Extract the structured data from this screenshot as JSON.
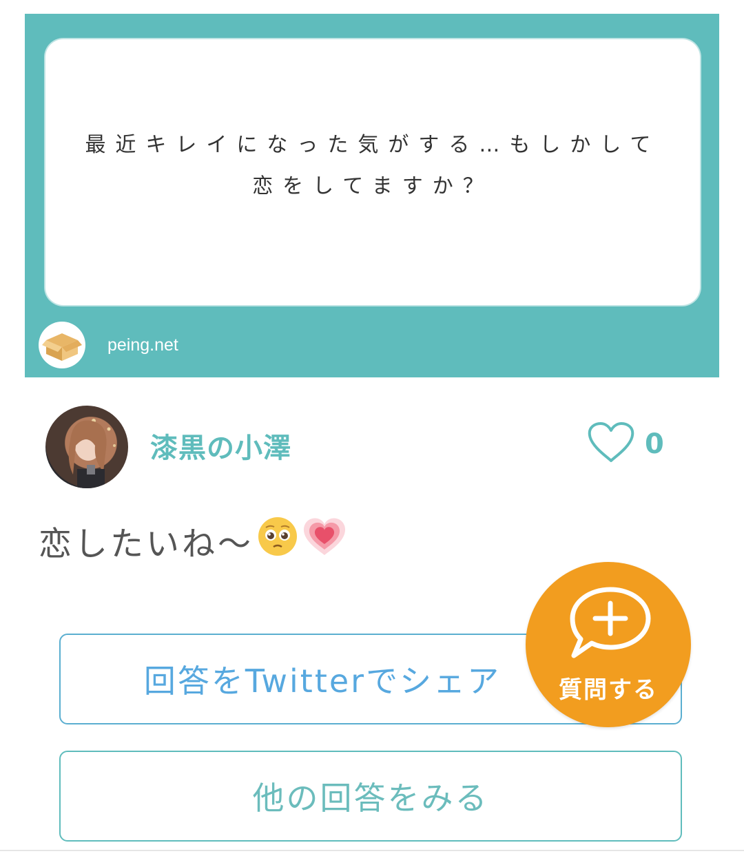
{
  "question_card": {
    "text": "最近キレイになった気がする…もしかして恋をしてますか？",
    "site": "peing.net",
    "logo_icon": "cardboard-box-icon",
    "background_color": "#5fbcbc"
  },
  "answer_header": {
    "username": "漆黒の小澤",
    "like_count": "0",
    "like_icon": "heart-outline-icon",
    "accent_color": "#5fbcbc"
  },
  "answer": {
    "text": "恋したいね〜",
    "emojis": [
      "pleading-face-emoji",
      "growing-heart-emoji"
    ]
  },
  "buttons": {
    "share_label": "回答をTwitterでシェア",
    "more_label": "他の回答をみる"
  },
  "fab": {
    "label": "質問する",
    "icon": "speech-bubble-plus-icon",
    "color": "#f29d1f"
  }
}
